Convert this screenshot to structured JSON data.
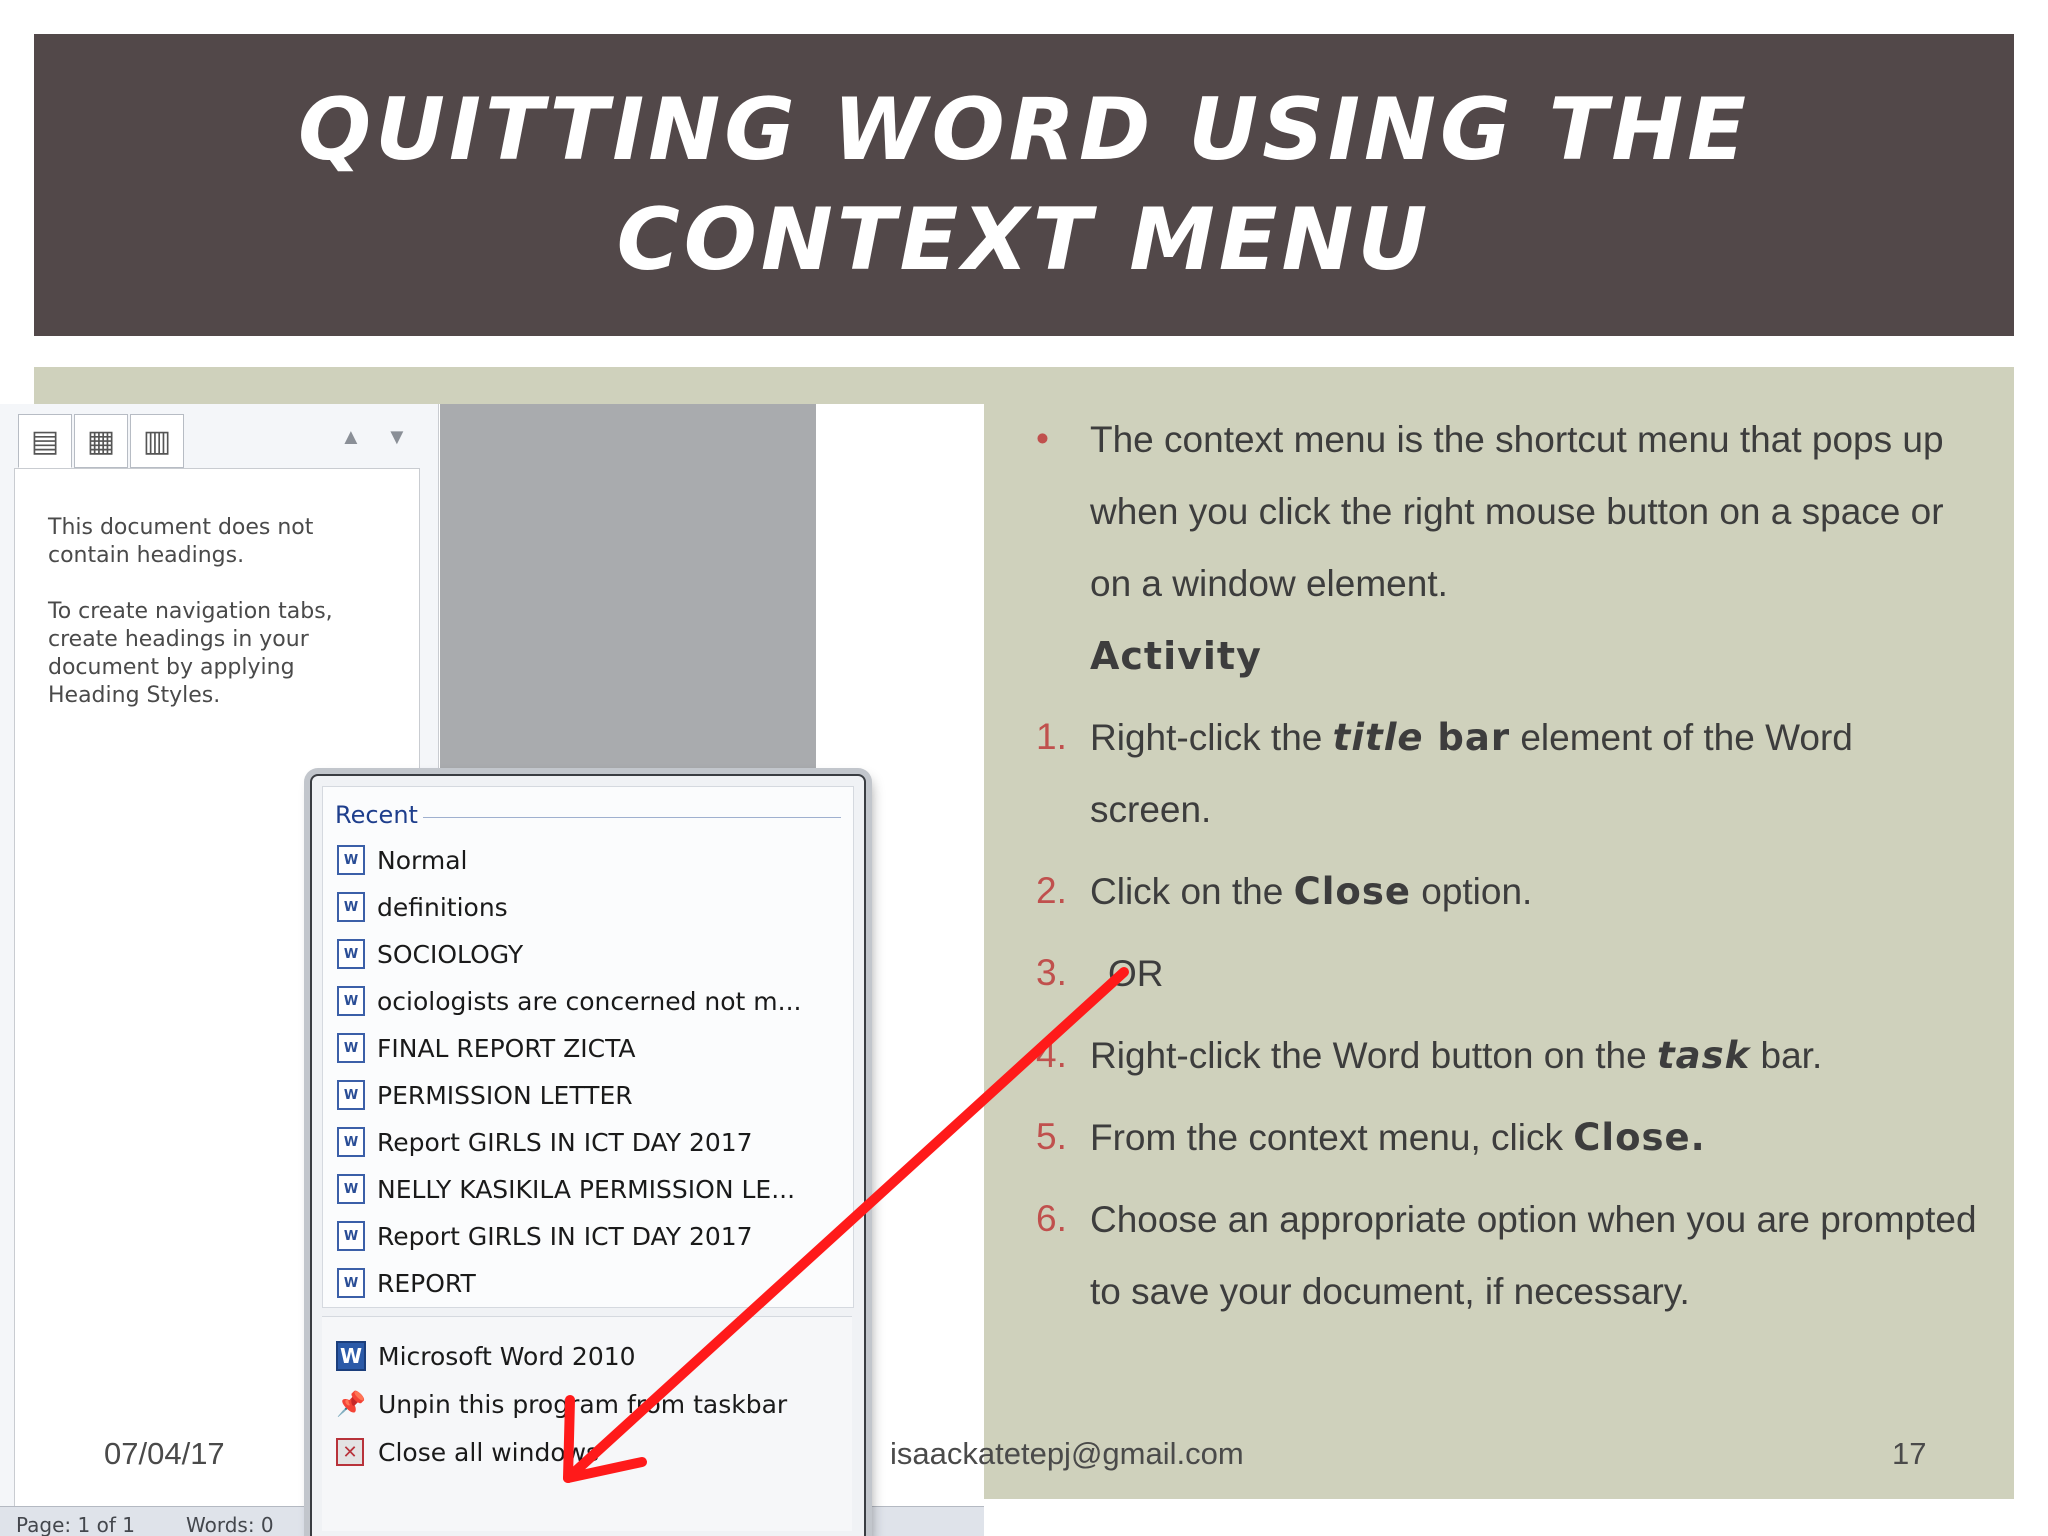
{
  "slide": {
    "title": "QUITTING WORD USING THE CONTEXT MENU",
    "date": "07/04/17",
    "email": "isaackatetepj@gmail.com",
    "page_number": "17"
  },
  "nav_pane": {
    "message_line1": "This document does not contain headings.",
    "message_line2": "To create navigation tabs, create headings in your document by applying Heading Styles.",
    "tab_icons": [
      "browse-headings-icon",
      "browse-pages-icon",
      "browse-results-icon"
    ]
  },
  "status_bar": {
    "page": "Page: 1 of 1",
    "words": "Words: 0"
  },
  "jump_list": {
    "recent_heading": "Recent",
    "recent_items": [
      "Normal",
      "definitions",
      "SOCIOLOGY",
      "ociologists are concerned not m...",
      "FINAL REPORT ZICTA",
      "PERMISSION LETTER",
      "Report GIRLS IN ICT DAY 2017",
      "NELLY KASIKILA PERMISSION LE...",
      "Report GIRLS IN ICT DAY 2017",
      "REPORT"
    ],
    "app_name": "Microsoft Word 2010",
    "unpin_label": "Unpin this program from taskbar",
    "close_all_label": "Close all windows"
  },
  "content": {
    "bullet_marker": "•",
    "intro": "The context menu is the shortcut menu that pops up when you click the right mouse button on a space or on a window element.",
    "activity_heading": "Activity",
    "steps": [
      {
        "num": "1.",
        "before": "Right-click the ",
        "bold_italic": "title",
        "bold": " bar",
        "after": " element of the Word screen."
      },
      {
        "num": "2.",
        "before": "Click on the ",
        "bold": "Close",
        "after": " option."
      },
      {
        "num": "3.",
        "text": "OR"
      },
      {
        "num": "4.",
        "before": "Right-click the Word button on the ",
        "bold_italic": "task",
        "after": " bar."
      },
      {
        "num": "5.",
        "before": "From the context menu, click ",
        "bold": "Close."
      },
      {
        "num": "6.",
        "text": "Choose an appropriate option when you are prompted to save your document, if necessary."
      }
    ]
  },
  "colors": {
    "title_band": "#524849",
    "content_panel": "#cfd1bc",
    "marker": "#c0504d",
    "arrow": "#ff1a1a"
  }
}
